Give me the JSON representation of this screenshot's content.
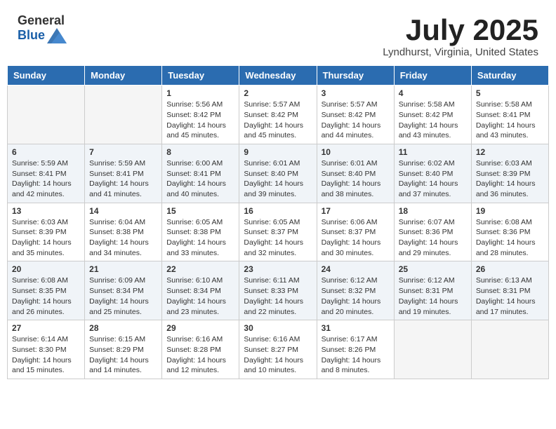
{
  "header": {
    "logo_general": "General",
    "logo_blue": "Blue",
    "month_year": "July 2025",
    "location": "Lyndhurst, Virginia, United States"
  },
  "days_of_week": [
    "Sunday",
    "Monday",
    "Tuesday",
    "Wednesday",
    "Thursday",
    "Friday",
    "Saturday"
  ],
  "weeks": [
    [
      {
        "day": "",
        "empty": true
      },
      {
        "day": "",
        "empty": true
      },
      {
        "day": "1",
        "sunrise": "5:56 AM",
        "sunset": "8:42 PM",
        "daylight": "14 hours and 45 minutes."
      },
      {
        "day": "2",
        "sunrise": "5:57 AM",
        "sunset": "8:42 PM",
        "daylight": "14 hours and 45 minutes."
      },
      {
        "day": "3",
        "sunrise": "5:57 AM",
        "sunset": "8:42 PM",
        "daylight": "14 hours and 44 minutes."
      },
      {
        "day": "4",
        "sunrise": "5:58 AM",
        "sunset": "8:42 PM",
        "daylight": "14 hours and 43 minutes."
      },
      {
        "day": "5",
        "sunrise": "5:58 AM",
        "sunset": "8:41 PM",
        "daylight": "14 hours and 43 minutes."
      }
    ],
    [
      {
        "day": "6",
        "sunrise": "5:59 AM",
        "sunset": "8:41 PM",
        "daylight": "14 hours and 42 minutes."
      },
      {
        "day": "7",
        "sunrise": "5:59 AM",
        "sunset": "8:41 PM",
        "daylight": "14 hours and 41 minutes."
      },
      {
        "day": "8",
        "sunrise": "6:00 AM",
        "sunset": "8:41 PM",
        "daylight": "14 hours and 40 minutes."
      },
      {
        "day": "9",
        "sunrise": "6:01 AM",
        "sunset": "8:40 PM",
        "daylight": "14 hours and 39 minutes."
      },
      {
        "day": "10",
        "sunrise": "6:01 AM",
        "sunset": "8:40 PM",
        "daylight": "14 hours and 38 minutes."
      },
      {
        "day": "11",
        "sunrise": "6:02 AM",
        "sunset": "8:40 PM",
        "daylight": "14 hours and 37 minutes."
      },
      {
        "day": "12",
        "sunrise": "6:03 AM",
        "sunset": "8:39 PM",
        "daylight": "14 hours and 36 minutes."
      }
    ],
    [
      {
        "day": "13",
        "sunrise": "6:03 AM",
        "sunset": "8:39 PM",
        "daylight": "14 hours and 35 minutes."
      },
      {
        "day": "14",
        "sunrise": "6:04 AM",
        "sunset": "8:38 PM",
        "daylight": "14 hours and 34 minutes."
      },
      {
        "day": "15",
        "sunrise": "6:05 AM",
        "sunset": "8:38 PM",
        "daylight": "14 hours and 33 minutes."
      },
      {
        "day": "16",
        "sunrise": "6:05 AM",
        "sunset": "8:37 PM",
        "daylight": "14 hours and 32 minutes."
      },
      {
        "day": "17",
        "sunrise": "6:06 AM",
        "sunset": "8:37 PM",
        "daylight": "14 hours and 30 minutes."
      },
      {
        "day": "18",
        "sunrise": "6:07 AM",
        "sunset": "8:36 PM",
        "daylight": "14 hours and 29 minutes."
      },
      {
        "day": "19",
        "sunrise": "6:08 AM",
        "sunset": "8:36 PM",
        "daylight": "14 hours and 28 minutes."
      }
    ],
    [
      {
        "day": "20",
        "sunrise": "6:08 AM",
        "sunset": "8:35 PM",
        "daylight": "14 hours and 26 minutes."
      },
      {
        "day": "21",
        "sunrise": "6:09 AM",
        "sunset": "8:34 PM",
        "daylight": "14 hours and 25 minutes."
      },
      {
        "day": "22",
        "sunrise": "6:10 AM",
        "sunset": "8:34 PM",
        "daylight": "14 hours and 23 minutes."
      },
      {
        "day": "23",
        "sunrise": "6:11 AM",
        "sunset": "8:33 PM",
        "daylight": "14 hours and 22 minutes."
      },
      {
        "day": "24",
        "sunrise": "6:12 AM",
        "sunset": "8:32 PM",
        "daylight": "14 hours and 20 minutes."
      },
      {
        "day": "25",
        "sunrise": "6:12 AM",
        "sunset": "8:31 PM",
        "daylight": "14 hours and 19 minutes."
      },
      {
        "day": "26",
        "sunrise": "6:13 AM",
        "sunset": "8:31 PM",
        "daylight": "14 hours and 17 minutes."
      }
    ],
    [
      {
        "day": "27",
        "sunrise": "6:14 AM",
        "sunset": "8:30 PM",
        "daylight": "14 hours and 15 minutes."
      },
      {
        "day": "28",
        "sunrise": "6:15 AM",
        "sunset": "8:29 PM",
        "daylight": "14 hours and 14 minutes."
      },
      {
        "day": "29",
        "sunrise": "6:16 AM",
        "sunset": "8:28 PM",
        "daylight": "14 hours and 12 minutes."
      },
      {
        "day": "30",
        "sunrise": "6:16 AM",
        "sunset": "8:27 PM",
        "daylight": "14 hours and 10 minutes."
      },
      {
        "day": "31",
        "sunrise": "6:17 AM",
        "sunset": "8:26 PM",
        "daylight": "14 hours and 8 minutes."
      },
      {
        "day": "",
        "empty": true
      },
      {
        "day": "",
        "empty": true
      }
    ]
  ],
  "labels": {
    "sunrise_prefix": "Sunrise: ",
    "sunset_prefix": "Sunset: ",
    "daylight_prefix": "Daylight: "
  }
}
